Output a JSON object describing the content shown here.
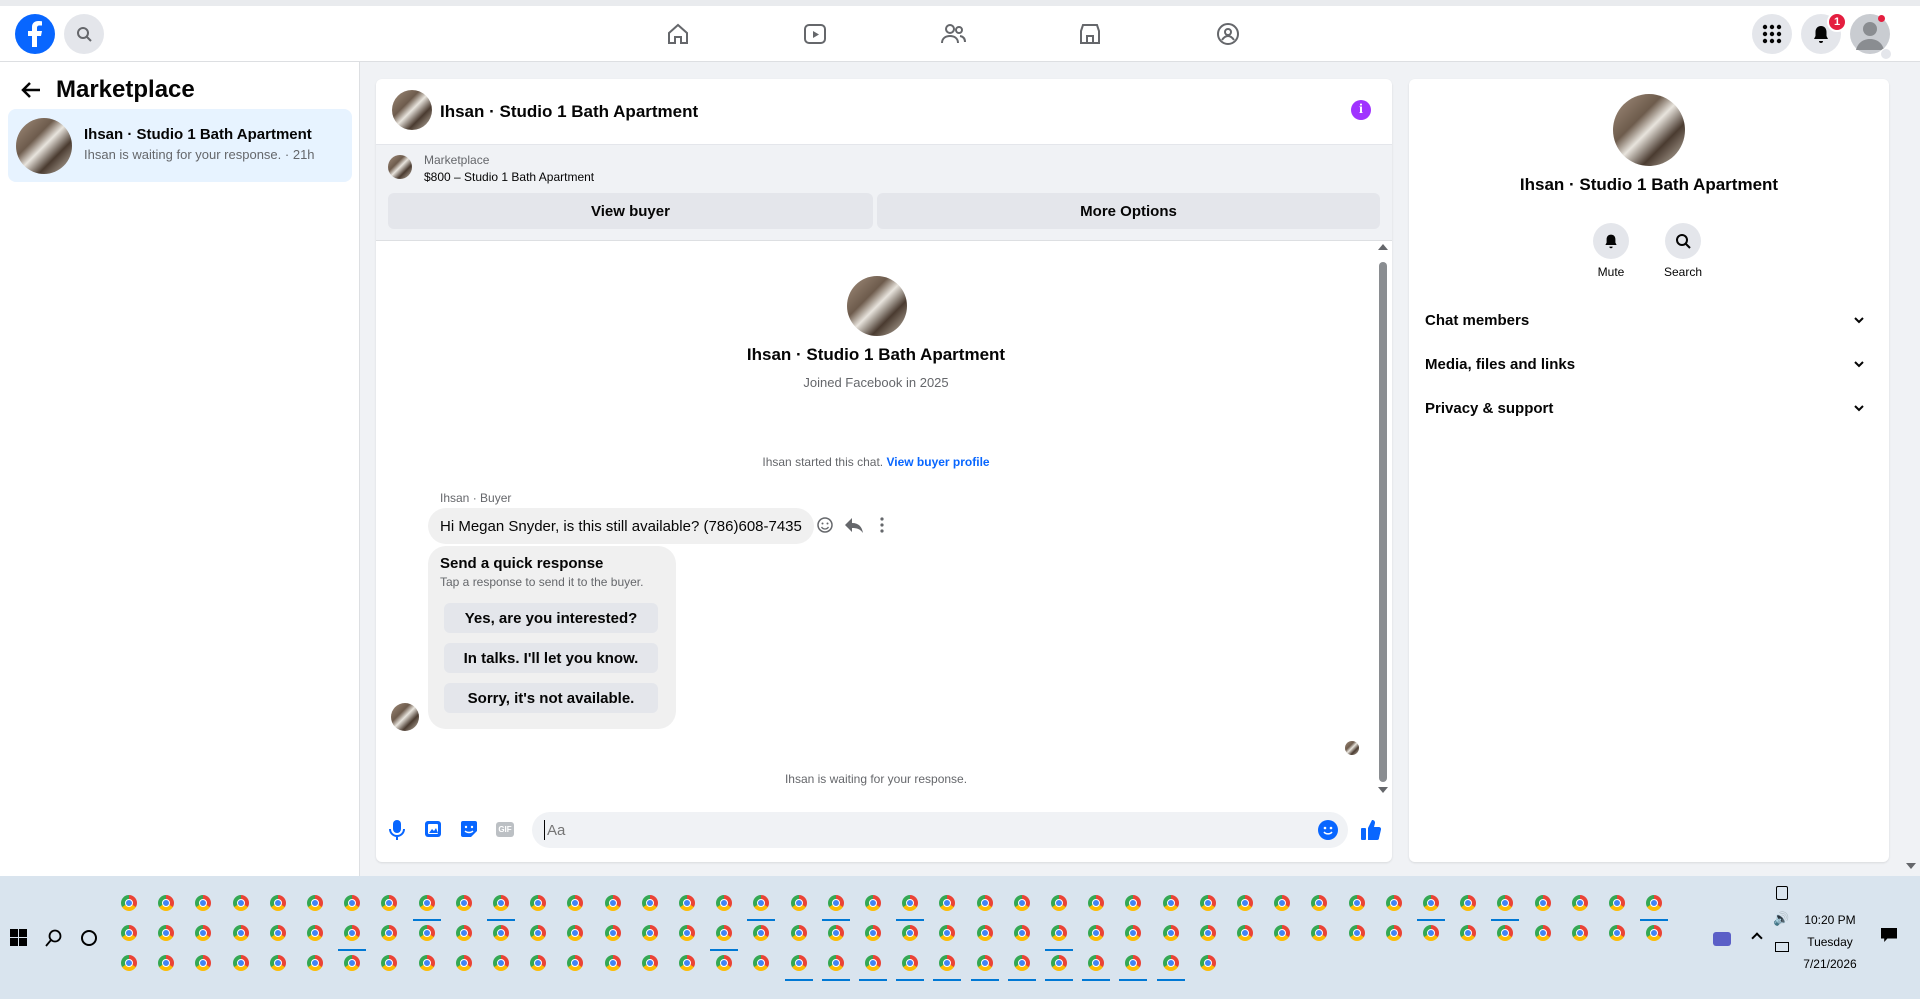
{
  "header": {
    "badge_count": "1"
  },
  "left": {
    "title": "Marketplace",
    "conversation": {
      "name": "Ihsan · Studio 1 Bath Apartment",
      "preview": "Ihsan is waiting for your response.",
      "time": "21h"
    }
  },
  "chat": {
    "title": "Ihsan · Studio 1 Bath Apartment",
    "listing_label": "Marketplace",
    "listing_price": "$800 – Studio 1 Bath Apartment",
    "view_buyer": "View buyer",
    "more_options": "More Options",
    "profile_name": "Ihsan · Studio 1 Bath Apartment",
    "joined": "Joined Facebook in 2025",
    "started_text": "Ihsan started this chat.",
    "view_profile_link": "View buyer profile",
    "sender_label": "Ihsan · Buyer",
    "message": "Hi Megan Snyder, is this still available? (786)608-7435",
    "quick_title": "Send a quick response",
    "quick_sub": "Tap a response to send it to the buyer.",
    "quick_replies": [
      "Yes, are you interested?",
      "In talks. I'll let you know.",
      "Sorry, it's not available."
    ],
    "waiting": "Ihsan is waiting for your response.",
    "composer_placeholder": "Aa",
    "info_color": "#a033ff",
    "accent": "#0866ff"
  },
  "info": {
    "name": "Ihsan · Studio 1 Bath Apartment",
    "mute": "Mute",
    "search": "Search",
    "sections": [
      "Chat members",
      "Media, files and links",
      "Privacy & support"
    ]
  },
  "taskbar": {
    "time": "10:20 PM",
    "day": "Tuesday",
    "date": "7/21/2026"
  }
}
